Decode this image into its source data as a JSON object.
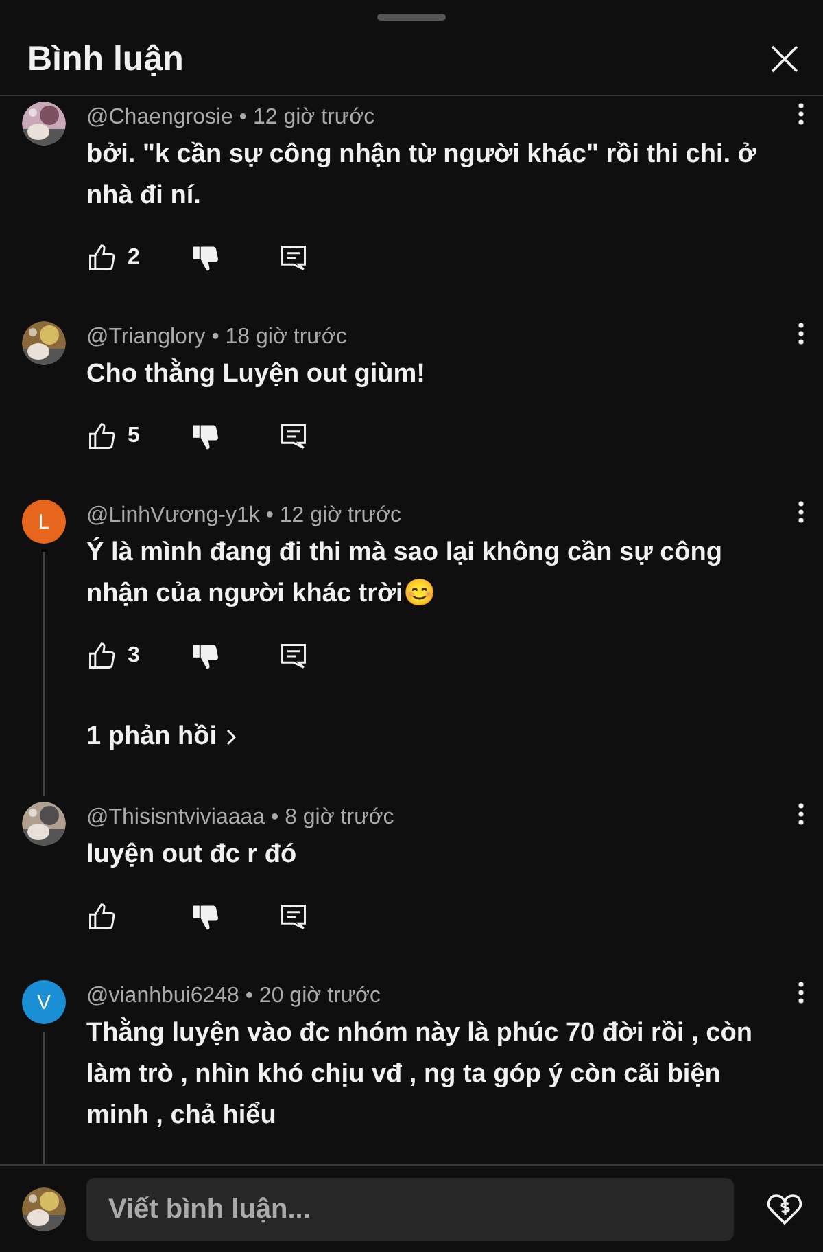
{
  "header": {
    "title": "Bình luận"
  },
  "comments": [
    {
      "meta": "@Chaengrosie • 12 giờ trước",
      "text": "bởi. \"k cần sự công nhận từ người khác\" rồi thi chi. ở nhà đi ní.",
      "likes": "2",
      "thread_line": false
    },
    {
      "meta": "@Trianglory • 18 giờ trước",
      "text": "Cho thằng Luyện out giùm!",
      "likes": "5",
      "thread_line": false
    },
    {
      "meta": "@LinhVương-y1k • 12 giờ trước",
      "avatar": {
        "kind": "letter",
        "letter": "L",
        "color": "#e6661e"
      },
      "text": "Ý là mình đang đi thi mà sao lại không cần sự công nhận của người khác trời😊",
      "likes": "3",
      "thread_line": true,
      "replies": "1 phản hồi"
    },
    {
      "meta": "@Thisisntviviaaaa • 8 giờ trước",
      "text": "luyện out đc r đó",
      "thread_line": false
    },
    {
      "meta": "@vianhbui6248 • 20 giờ trước",
      "avatar": {
        "kind": "letter",
        "letter": "V",
        "color": "#1a8fd6"
      },
      "text": "Thằng luyện vào đc nhóm này là phúc 70 đời rồi , còn làm trò , nhìn khó chịu vđ , ng ta góp ý còn cãi biện minh , chả hiểu",
      "thread_line": true
    }
  ],
  "composer": {
    "placeholder": "Viết bình luận..."
  }
}
